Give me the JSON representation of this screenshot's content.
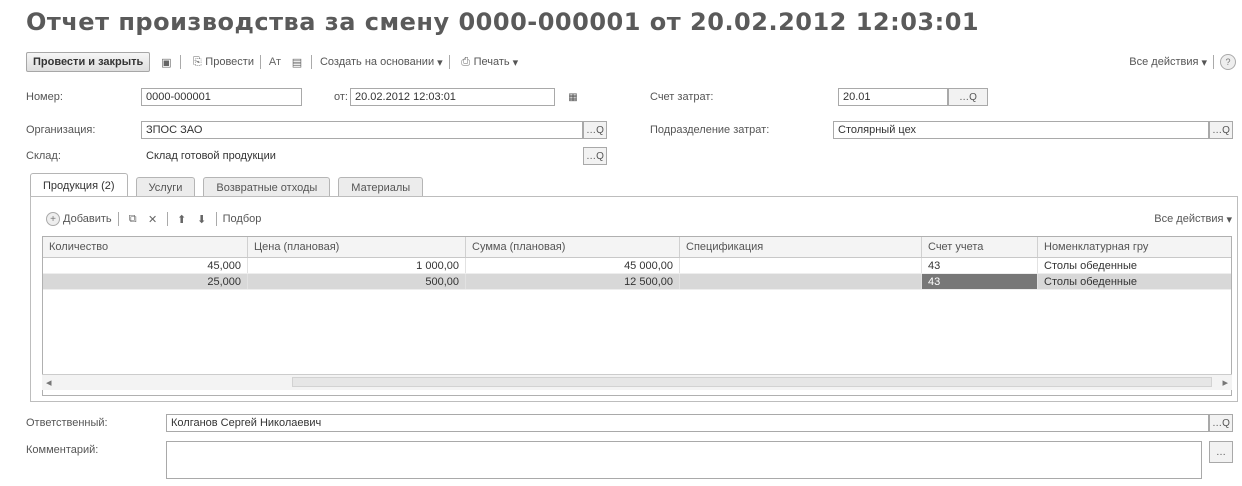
{
  "title": "Отчет производства за смену 0000-000001 от 20.02.2012 12:03:01",
  "toolbar": {
    "post_close": "Провести и закрыть",
    "post": "Провести",
    "create_based_on": "Создать на основании",
    "print": "Печать",
    "all_actions": "Все действия"
  },
  "fields": {
    "number_label": "Номер:",
    "number_value": "0000-000001",
    "date_label": "от:",
    "date_value": "20.02.2012 12:03:01",
    "cost_account_label": "Счет затрат:",
    "cost_account_value": "20.01",
    "org_label": "Организация:",
    "org_value": "ЗПОС ЗАО",
    "cost_division_label": "Подразделение затрат:",
    "cost_division_value": "Столярный цех",
    "warehouse_label": "Склад:",
    "warehouse_value": "Склад готовой продукции",
    "responsible_label": "Ответственный:",
    "responsible_value": "Колганов Сергей Николаевич",
    "comment_label": "Комментарий:",
    "comment_value": ""
  },
  "tabs": [
    "Продукция (2)",
    "Услуги",
    "Возвратные отходы",
    "Материалы"
  ],
  "grid_toolbar": {
    "add": "Добавить",
    "selection": "Подбор",
    "all_actions": "Все действия"
  },
  "grid": {
    "columns": [
      "Количество",
      "Цена (плановая)",
      "Сумма (плановая)",
      "Спецификация",
      "Счет учета",
      "Номенклатурная гру"
    ],
    "rows": [
      {
        "qty": "45,000",
        "price": "1 000,00",
        "sum": "45 000,00",
        "spec": "",
        "account": "43",
        "group": "Столы обеденные"
      },
      {
        "qty": "25,000",
        "price": "500,00",
        "sum": "12 500,00",
        "spec": "",
        "account": "43",
        "group": "Столы обеденные"
      }
    ]
  }
}
